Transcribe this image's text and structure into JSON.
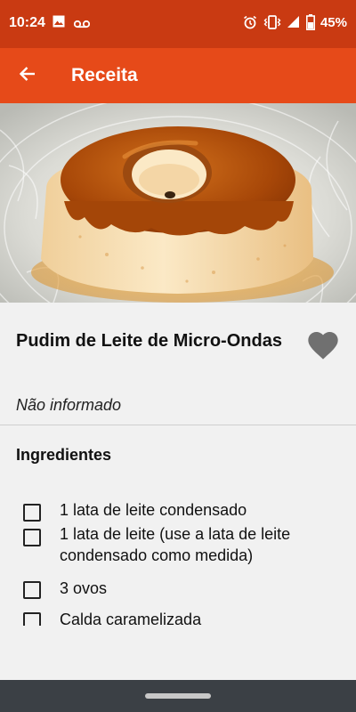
{
  "status_bar": {
    "time": "10:24",
    "battery": "45%",
    "left_icons": [
      "image-icon",
      "voicemail-icon"
    ],
    "right_icons": [
      "alarm-icon",
      "vibrate-icon",
      "signal-icon",
      "battery-icon"
    ]
  },
  "app_bar": {
    "title": "Receita",
    "back_icon": "arrow-back-icon",
    "background": "#e64a19",
    "status_background": "#c93a12"
  },
  "recipe": {
    "title": "Pudim de Leite de Micro-Ondas",
    "meta": "Não informado",
    "favorite_icon": "heart-icon",
    "image_subject": "pudim-de-leite"
  },
  "ingredients": {
    "heading": "Ingredientes",
    "items": [
      {
        "text": "1 lata de leite condensado",
        "checked": false
      },
      {
        "text": "1 lata de leite (use a lata de leite condensado como medida)",
        "checked": false
      },
      {
        "text": "3 ovos",
        "checked": false
      },
      {
        "text": "Calda caramelizada",
        "checked": false
      }
    ]
  }
}
